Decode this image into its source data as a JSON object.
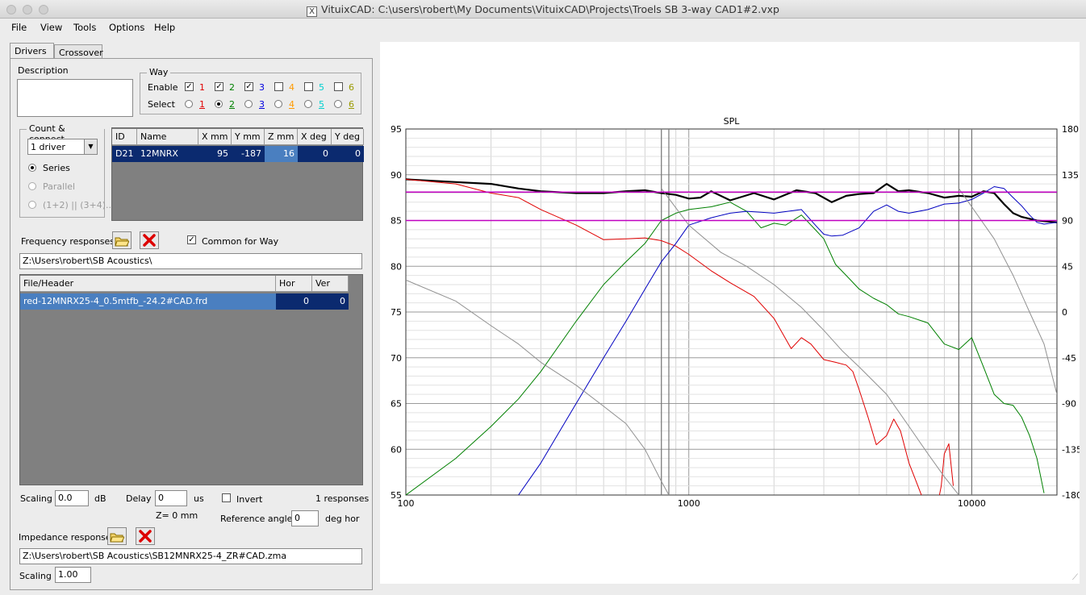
{
  "window": {
    "title": "VituixCAD: C:\\users\\robert\\My Documents\\VituixCAD\\Projects\\Troels SB 3-way CAD1#2.vxp"
  },
  "menu": [
    "File",
    "View",
    "Tools",
    "Options",
    "Help"
  ],
  "tabs": {
    "drivers": "Drivers",
    "crossover": "Crossover"
  },
  "description": {
    "label": "Description",
    "value": ""
  },
  "way": {
    "title": "Way",
    "enable_label": "Enable",
    "select_label": "Select",
    "items": [
      {
        "num": "1",
        "color": "#e00000",
        "enabled": true,
        "selected": false
      },
      {
        "num": "2",
        "color": "#008000",
        "enabled": true,
        "selected": true
      },
      {
        "num": "3",
        "color": "#0000e0",
        "enabled": true,
        "selected": false
      },
      {
        "num": "4",
        "color": "#ff9a00",
        "enabled": false,
        "selected": false
      },
      {
        "num": "5",
        "color": "#00d0d0",
        "enabled": false,
        "selected": false
      },
      {
        "num": "6",
        "color": "#9a9a00",
        "enabled": false,
        "selected": false
      }
    ]
  },
  "count_connect": {
    "title": "Count & connect",
    "driver_select": "1 driver",
    "options": [
      {
        "label": "Series",
        "selected": true,
        "enabled": true
      },
      {
        "label": "Parallel",
        "selected": false,
        "enabled": false
      },
      {
        "label": "(1+2) || (3+4)...",
        "selected": false,
        "enabled": false
      }
    ]
  },
  "driver_table": {
    "headers": [
      "ID",
      "Name",
      "X mm",
      "Y mm",
      "Z mm",
      "X deg",
      "Y deg"
    ],
    "rows": [
      [
        "D21",
        "12MNRX",
        "95",
        "-187",
        "16",
        "0",
        "0"
      ]
    ]
  },
  "freq": {
    "label": "Frequency responses",
    "common_label": "Common for Way",
    "common_checked": true,
    "path": "Z:\\Users\\robert\\SB Acoustics\\",
    "headers": [
      "File/Header",
      "Hor",
      "Ver"
    ],
    "rows": [
      [
        "red-12MNRX25-4_0.5mtfb_-24.2#CAD.frd",
        "0",
        "0"
      ]
    ]
  },
  "scaling": {
    "label": "Scaling",
    "value": "0.0",
    "unit": "dB"
  },
  "delay": {
    "label": "Delay",
    "value": "0",
    "unit": "us",
    "z_label": "Z= 0 mm"
  },
  "invert": {
    "label": "Invert",
    "checked": false
  },
  "responses_count": "1 responses",
  "ref_angle": {
    "label": "Reference angle",
    "value": "0",
    "unit": "deg hor"
  },
  "impedance": {
    "label": "Impedance response",
    "path": "Z:\\Users\\robert\\SB Acoustics\\SB12MNRX25-4_ZR#CAD.zma",
    "scaling_label": "Scaling",
    "scaling_value": "1.00"
  },
  "chart_data": {
    "type": "line",
    "title": "SPL",
    "x_scale": "log",
    "xlim": [
      100,
      20000
    ],
    "ylim": [
      55,
      95
    ],
    "y2lim": [
      -180,
      180
    ],
    "x_ticks": [
      "100",
      "1000",
      "10000"
    ],
    "y_ticks": [
      "95",
      "90",
      "85",
      "80",
      "75",
      "70",
      "65",
      "60",
      "55"
    ],
    "y2_ticks": [
      "180",
      "135",
      "90",
      "45",
      "0",
      "-45",
      "-90",
      "-135",
      "-180"
    ],
    "grid": true,
    "series": [
      {
        "color": "#000000",
        "width": 2.2,
        "x": [
          100,
          150,
          200,
          250,
          300,
          400,
          500,
          600,
          700,
          800,
          900,
          1000,
          1100,
          1200,
          1400,
          1700,
          2000,
          2400,
          2800,
          3200,
          3600,
          4000,
          4500,
          5000,
          5500,
          6000,
          7000,
          8000,
          9000,
          10000,
          11000,
          12000,
          13000,
          14000,
          15000,
          17000,
          20000
        ],
        "y": [
          89.5,
          89.2,
          89,
          88.5,
          88.2,
          88,
          88,
          88.2,
          88.3,
          88,
          87.8,
          87.4,
          87.5,
          88.2,
          87.2,
          88,
          87.3,
          88.3,
          88,
          87,
          87.7,
          87.9,
          88,
          89,
          88.2,
          88.3,
          88.0,
          87.5,
          87.7,
          87.6,
          88.2,
          88,
          86.8,
          85.8,
          85.4,
          85,
          84.8
        ]
      },
      {
        "color": "#e00000",
        "width": 1,
        "x": [
          100,
          150,
          200,
          250,
          300,
          400,
          500,
          600,
          700,
          800,
          900,
          1000,
          1200,
          1400,
          1700,
          2000,
          2300,
          2500,
          2700,
          3000,
          3300,
          3600,
          3800,
          4000,
          4300,
          4600,
          5000,
          5300,
          5600,
          6000,
          6300,
          6600,
          7000,
          7300,
          7600,
          7800,
          8000,
          8300,
          8600
        ],
        "y": [
          89.5,
          89,
          88,
          87.5,
          86.2,
          84.5,
          82.9,
          83,
          83.1,
          82.8,
          82.2,
          81.3,
          79.5,
          78.2,
          76.7,
          74.3,
          71,
          72.2,
          71.5,
          69.8,
          69.5,
          69.2,
          68.5,
          66.5,
          63.5,
          60.5,
          61.5,
          63.3,
          62,
          58.5,
          56.8,
          55.2,
          53.3,
          53,
          54.2,
          56,
          59.5,
          60.6,
          56
        ]
      },
      {
        "color": "#008000",
        "width": 1,
        "x": [
          100,
          150,
          200,
          250,
          300,
          400,
          500,
          600,
          700,
          800,
          900,
          1000,
          1200,
          1400,
          1600,
          1800,
          2000,
          2200,
          2500,
          2800,
          3000,
          3300,
          3600,
          4000,
          4500,
          5000,
          5500,
          6000,
          7000,
          8000,
          9000,
          10000,
          11000,
          12000,
          13000,
          14000,
          15000,
          16000,
          17000,
          18000
        ],
        "y": [
          55,
          59,
          62.5,
          65.5,
          68.5,
          74,
          78,
          80.5,
          82.5,
          85,
          85.8,
          86.2,
          86.5,
          87,
          86,
          84.2,
          84.7,
          84.5,
          85.6,
          84,
          83,
          80.2,
          79,
          77.5,
          76.5,
          75.8,
          74.8,
          74.5,
          73.8,
          71.5,
          70.9,
          72.2,
          69,
          66,
          65,
          64.8,
          63.5,
          61.5,
          59,
          55.2
        ]
      },
      {
        "color": "#0000c0",
        "width": 1,
        "x": [
          250,
          300,
          350,
          400,
          500,
          600,
          700,
          800,
          900,
          1000,
          1200,
          1400,
          1600,
          1800,
          2000,
          2500,
          2800,
          3000,
          3200,
          3500,
          4000,
          4500,
          5000,
          5500,
          6000,
          7000,
          8000,
          9000,
          10000,
          11000,
          12000,
          13000,
          14000,
          15000,
          16000,
          17000,
          18000,
          20000
        ],
        "y": [
          55,
          58.5,
          62,
          65,
          70,
          74,
          77.5,
          80.5,
          82.5,
          84.5,
          85.3,
          85.8,
          86,
          85.9,
          85.8,
          86.2,
          84.5,
          83.5,
          83.3,
          83.4,
          84.2,
          86,
          86.7,
          86,
          85.8,
          86.2,
          86.8,
          86.9,
          87.3,
          88.0,
          88.7,
          88.5,
          87.5,
          86.6,
          85.6,
          84.8,
          84.6,
          84.8
        ]
      },
      {
        "color": "#909090",
        "width": 1,
        "x": [
          100,
          150,
          200,
          250,
          300,
          400,
          500,
          600,
          700,
          800,
          850
        ],
        "y": [
          78.5,
          76.2,
          73.5,
          71.5,
          69.5,
          67,
          64.7,
          62.8,
          60,
          56.5,
          55
        ]
      },
      {
        "color": "#909090",
        "width": 1,
        "x": [
          800,
          1000,
          1300,
          1600,
          2000,
          2500,
          3000,
          3500,
          4000,
          5000,
          6000,
          7000,
          8000,
          9000
        ],
        "y": [
          88.5,
          84.5,
          81.5,
          80,
          78,
          75.5,
          73,
          70.7,
          69,
          66,
          62.5,
          59.5,
          57,
          55
        ]
      },
      {
        "color": "#909090",
        "width": 1,
        "x": [
          9000,
          10000,
          12000,
          14000,
          16000,
          18000,
          20000
        ],
        "y": [
          88.5,
          86.5,
          83,
          79,
          75,
          71.5,
          66
        ]
      },
      {
        "color": "#c000c0",
        "width": 1.5,
        "x": [
          100,
          20000
        ],
        "y": [
          88.1,
          88.1
        ]
      },
      {
        "color": "#c000c0",
        "width": 1.5,
        "x": [
          100,
          20000
        ],
        "y": [
          85,
          85
        ]
      }
    ],
    "vlines": [
      {
        "x": 800,
        "color": "#777777"
      },
      {
        "x": 850,
        "color": "#777777"
      },
      {
        "x": 9000,
        "color": "#777777"
      },
      {
        "x": 10000,
        "color": "#777777"
      }
    ]
  }
}
